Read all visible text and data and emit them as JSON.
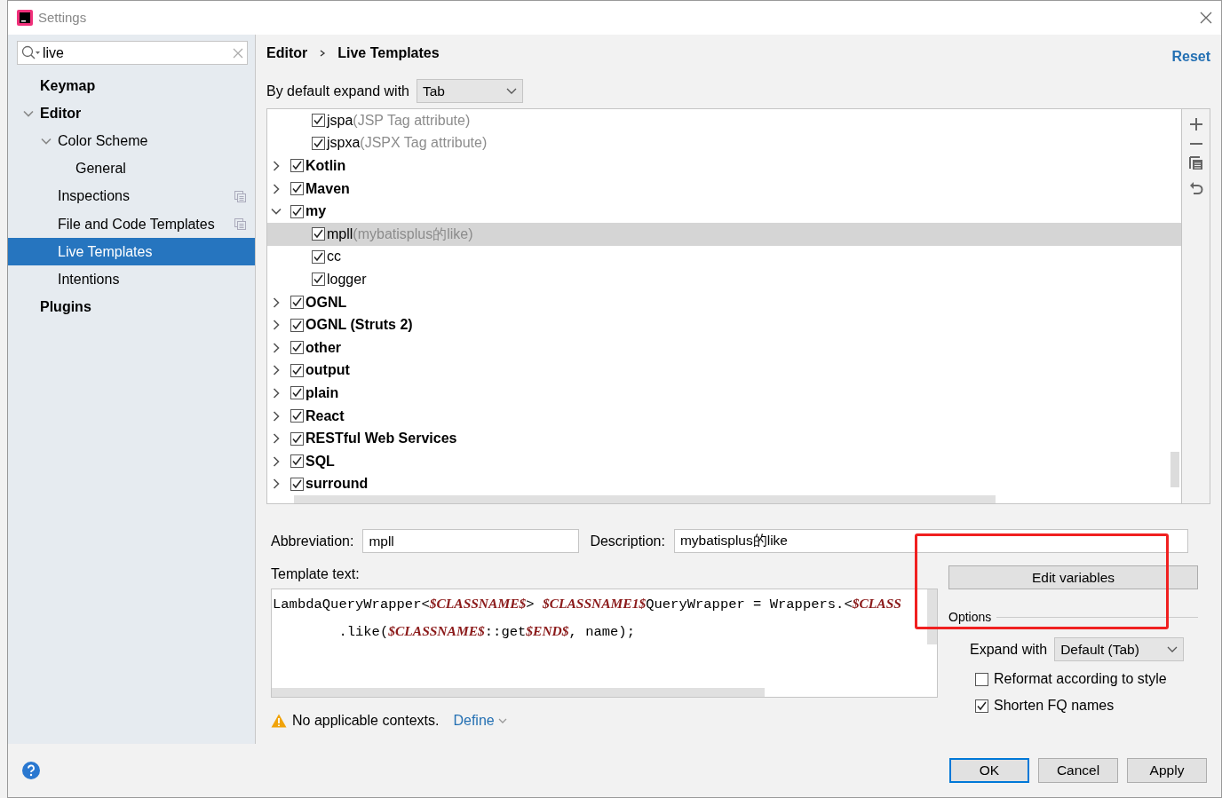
{
  "window": {
    "title": "Settings"
  },
  "search": {
    "value": "live"
  },
  "sidebar": {
    "items": [
      {
        "label": "Keymap",
        "bold": true,
        "selected": false
      },
      {
        "label": "Editor",
        "bold": true,
        "selected": false,
        "expanded": true,
        "children": [
          {
            "label": "Color Scheme",
            "selected": false,
            "expanded": true,
            "children": [
              {
                "label": "General",
                "selected": false
              }
            ]
          },
          {
            "label": "Inspections",
            "selected": false,
            "project_icon": true
          },
          {
            "label": "File and Code Templates",
            "selected": false,
            "project_icon": true
          },
          {
            "label": "Live Templates",
            "selected": true
          },
          {
            "label": "Intentions",
            "selected": false
          }
        ]
      },
      {
        "label": "Plugins",
        "bold": true,
        "selected": false
      }
    ]
  },
  "breadcrumb": [
    "Editor",
    "Live Templates"
  ],
  "reset": "Reset",
  "expand_default": {
    "label": "By default expand with",
    "value": "Tab"
  },
  "templates": [
    {
      "kind": "template",
      "abbr": "jspa",
      "desc": "(JSP Tag attribute)",
      "checked": true,
      "selected": false
    },
    {
      "kind": "template",
      "abbr": "jspxa",
      "desc": "(JSPX Tag attribute)",
      "checked": true,
      "selected": false
    },
    {
      "kind": "group",
      "name": "Kotlin",
      "checked": true,
      "expanded": false
    },
    {
      "kind": "group",
      "name": "Maven",
      "checked": true,
      "expanded": false
    },
    {
      "kind": "group",
      "name": "my",
      "checked": true,
      "expanded": true
    },
    {
      "kind": "template",
      "abbr": "mpll",
      "desc": "(mybatisplus的like)",
      "checked": true,
      "selected": true
    },
    {
      "kind": "template",
      "abbr": "cc",
      "checked": true,
      "selected": false
    },
    {
      "kind": "template",
      "abbr": "logger",
      "checked": true,
      "selected": false
    },
    {
      "kind": "group",
      "name": "OGNL",
      "checked": true,
      "expanded": false
    },
    {
      "kind": "group",
      "name": "OGNL (Struts 2)",
      "checked": true,
      "expanded": false
    },
    {
      "kind": "group",
      "name": "other",
      "checked": true,
      "expanded": false
    },
    {
      "kind": "group",
      "name": "output",
      "checked": true,
      "expanded": false
    },
    {
      "kind": "group",
      "name": "plain",
      "checked": true,
      "expanded": false
    },
    {
      "kind": "group",
      "name": "React",
      "checked": true,
      "expanded": false
    },
    {
      "kind": "group",
      "name": "RESTful Web Services",
      "checked": true,
      "expanded": false
    },
    {
      "kind": "group",
      "name": "SQL",
      "checked": true,
      "expanded": false
    },
    {
      "kind": "group",
      "name": "surround",
      "checked": true,
      "expanded": false
    }
  ],
  "abbreviation": {
    "label": "Abbreviation:",
    "value": "mpll"
  },
  "description": {
    "label": "Description:",
    "value": "mybatisplus的like"
  },
  "template_text": {
    "label": "Template text:",
    "lines": [
      [
        {
          "kind": "plain",
          "text": "LambdaQueryWrapper<"
        },
        {
          "kind": "var",
          "text": "$CLASSNAME$"
        },
        {
          "kind": "plain",
          "text": "> "
        },
        {
          "kind": "var",
          "text": "$CLASSNAME1$"
        },
        {
          "kind": "plain",
          "text": "QueryWrapper = Wrappers.<"
        },
        {
          "kind": "var",
          "text": "$CLASS"
        }
      ],
      [
        {
          "kind": "plain",
          "text": "        .like("
        },
        {
          "kind": "var",
          "text": "$CLASSNAME$"
        },
        {
          "kind": "plain",
          "text": "::get"
        },
        {
          "kind": "var",
          "text": "$END$"
        },
        {
          "kind": "plain",
          "text": ", name);"
        }
      ]
    ]
  },
  "edit_variables": "Edit variables",
  "options": {
    "title": "Options",
    "expand_label": "Expand with",
    "expand_value": "Default (Tab)",
    "checkboxes": [
      {
        "label": "Reformat according to style",
        "checked": false
      },
      {
        "label": "Shorten FQ names",
        "checked": true
      }
    ]
  },
  "warning": {
    "text": "No applicable contexts.",
    "link": "Define"
  },
  "buttons": [
    {
      "label": "OK",
      "default": true
    },
    {
      "label": "Cancel",
      "default": false
    },
    {
      "label": "Apply",
      "default": false
    }
  ]
}
